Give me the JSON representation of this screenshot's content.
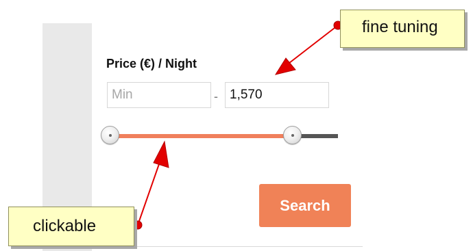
{
  "filter": {
    "label": "Price (€) / Night",
    "min_placeholder": "Min",
    "min_value": "",
    "separator": "-",
    "max_value": "1,570"
  },
  "slider": {
    "min_fraction": 0.0,
    "max_fraction": 0.8,
    "fill_color": "#f07f5c",
    "track_color": "#555555"
  },
  "search_button": {
    "label": "Search",
    "color": "#f08257"
  },
  "annotations": {
    "top_right": "fine tuning",
    "bottom_left": "clickable",
    "callout_color": "#ffffc4",
    "pointer_color": "#dd1111"
  }
}
